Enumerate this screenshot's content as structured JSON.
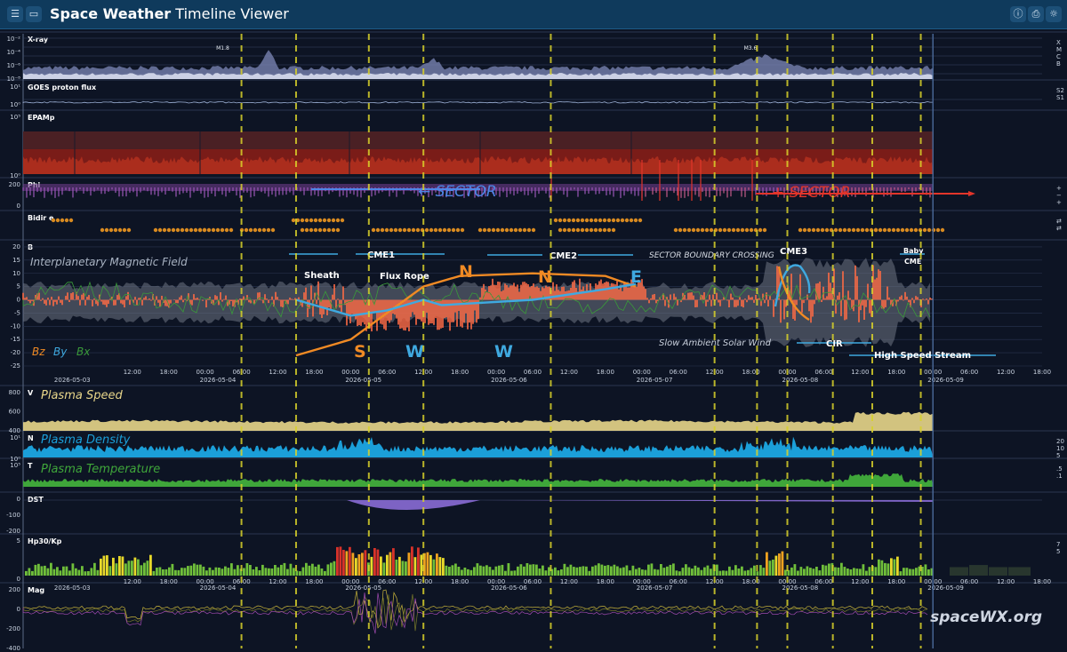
{
  "app": {
    "title_bold": "Space Weather",
    "title_rest": "Timeline Viewer",
    "buttons": [
      "menu",
      "inbox",
      "info",
      "export",
      "settings"
    ]
  },
  "watermark": "spaceWX.org",
  "chart_data": {
    "type": "line",
    "x_axis": {
      "type": "time",
      "start": "2026-05-02T18:00",
      "end": "2026-05-09T18:00",
      "major_ticks": [
        "12:00",
        "18:00",
        "00:00",
        "06:00",
        "12:00",
        "18:00",
        "00:00",
        "06:00",
        "12:00",
        "18:00",
        "00:00",
        "06:00",
        "12:00",
        "18:00",
        "00:00",
        "06:00",
        "12:00",
        "18:00",
        "00:00",
        "06:00",
        "12:00",
        "18:00",
        "00:00",
        "06:00",
        "12:00",
        "18:00",
        "00:00",
        "06:00",
        "12:00"
      ],
      "date_labels": [
        "2026-05-03",
        "2026-05-04",
        "2026-05-05",
        "2026-05-06",
        "2026-05-07",
        "2026-05-08",
        "2026-05-09"
      ],
      "data_end": "2026-05-09T00:00"
    },
    "event_lines_time": [
      "2026-05-04T06:00",
      "2026-05-04T15:00",
      "2026-05-05T03:00",
      "2026-05-05T12:00",
      "2026-05-06T09:00",
      "2026-05-07T12:00",
      "2026-05-07T19:00",
      "2026-05-08T00:00",
      "2026-05-08T07:30",
      "2026-05-08T14:00",
      "2026-05-08T22:00"
    ],
    "panels": [
      {
        "name": "X-ray",
        "yticks": [
          "10⁻²",
          "10⁻⁴",
          "10⁻⁶",
          "10⁻⁸"
        ],
        "right_labels": [
          "X",
          "M",
          "C",
          "B"
        ],
        "color": "#c8cfe8",
        "flare_labels": [
          "M1.8",
          "M3.6"
        ],
        "flare_times": [
          "2026-05-04T03:00",
          "2026-05-07T18:00"
        ]
      },
      {
        "name": "GOES proton flux",
        "yticks": [
          "10¹",
          "10⁰"
        ],
        "right_labels": [
          "S2",
          "S1"
        ],
        "color": "#9fb3d9"
      },
      {
        "name": "EPAMp",
        "yticks": [
          "10⁵",
          "10⁰"
        ],
        "color": "#a33028"
      },
      {
        "name": "Phi",
        "yticks": [
          "200",
          "0"
        ],
        "right_labels": [
          "+",
          "−",
          "+"
        ],
        "color": "#9a56b8",
        "sector_labels": [
          "← SECTOR",
          "+ SECTOR"
        ],
        "sector_colors": [
          "#4d86e6",
          "#e3352a"
        ]
      },
      {
        "name": "Bidir e",
        "right_labels": [
          "⇄",
          "⇄"
        ],
        "color": "#d88a20"
      },
      {
        "name": "B",
        "yticks": [
          "20",
          "15",
          "10",
          "5",
          "0",
          "-5",
          "-10",
          "-15",
          "-20",
          "-25"
        ],
        "ylim": [
          -25,
          22
        ],
        "subtitle": "Interplanetary Magnetic Field",
        "legend": [
          "Bz",
          "By",
          "Bx"
        ],
        "legend_colors": [
          "#f08a24",
          "#3fa9e0",
          "#3a9a3a"
        ],
        "annotations": [
          "CME1",
          "CME2",
          "SECTOR BOUNDARY CROSSING",
          "CME3",
          "Baby",
          "CME",
          "Sheath",
          "Flux Rope",
          "Slow Ambient Solar Wind",
          "CIR",
          "High Speed Stream"
        ],
        "letters": [
          "S",
          "N",
          "W",
          "W",
          "N",
          "E"
        ]
      },
      {
        "name": "V",
        "yticks": [
          "800",
          "600",
          "400"
        ],
        "subtitle": "Plasma Speed",
        "color": "#e8d68a",
        "ylim": [
          300,
          850
        ]
      },
      {
        "name": "N",
        "yticks": [
          "10¹",
          "10⁰"
        ],
        "right_labels": [
          "20",
          "10",
          "5"
        ],
        "subtitle": "Plasma Density",
        "color": "#1b9fd9"
      },
      {
        "name": "T",
        "yticks": [
          "10⁵"
        ],
        "right_labels": [
          ".5",
          ".1"
        ],
        "subtitle": "Plasma Temperature",
        "color": "#3fa63a"
      },
      {
        "name": "DST",
        "yticks": [
          "0",
          "-100",
          "-200"
        ],
        "color": "#8a6bd6",
        "ylim": [
          -200,
          20
        ]
      },
      {
        "name": "Hp30/Kp",
        "yticks": [
          "5",
          "0"
        ],
        "right_labels": [
          "7",
          "5"
        ],
        "ylim": [
          0,
          9
        ],
        "colors": [
          "#6fbf3a",
          "#e8d92a",
          "#f0a21f",
          "#d8322a"
        ]
      },
      {
        "name": "Mag",
        "yticks": [
          "200",
          "0",
          "-200",
          "-400"
        ],
        "ylim": [
          -420,
          220
        ]
      }
    ],
    "B_series": {
      "Bz_fit_orange": {
        "x": [
          "2026-05-04T15:00",
          "2026-05-05T00:00",
          "2026-05-05T06:00",
          "2026-05-05T12:00",
          "2026-05-05T18:00",
          "2026-05-06T06:00",
          "2026-05-06T18:00",
          "2026-05-06T23:00"
        ],
        "y": [
          -21,
          -15,
          -5,
          5,
          9,
          10,
          9,
          5
        ]
      },
      "By_fit_blue": {
        "x": [
          "2026-05-04T15:00",
          "2026-05-05T00:00",
          "2026-05-05T06:00",
          "2026-05-05T12:00",
          "2026-05-05T15:00",
          "2026-05-06T06:00",
          "2026-05-06T18:00",
          "2026-05-06T23:00"
        ],
        "y": [
          0,
          -6,
          -4,
          0,
          -2,
          0,
          4,
          6
        ]
      }
    }
  }
}
